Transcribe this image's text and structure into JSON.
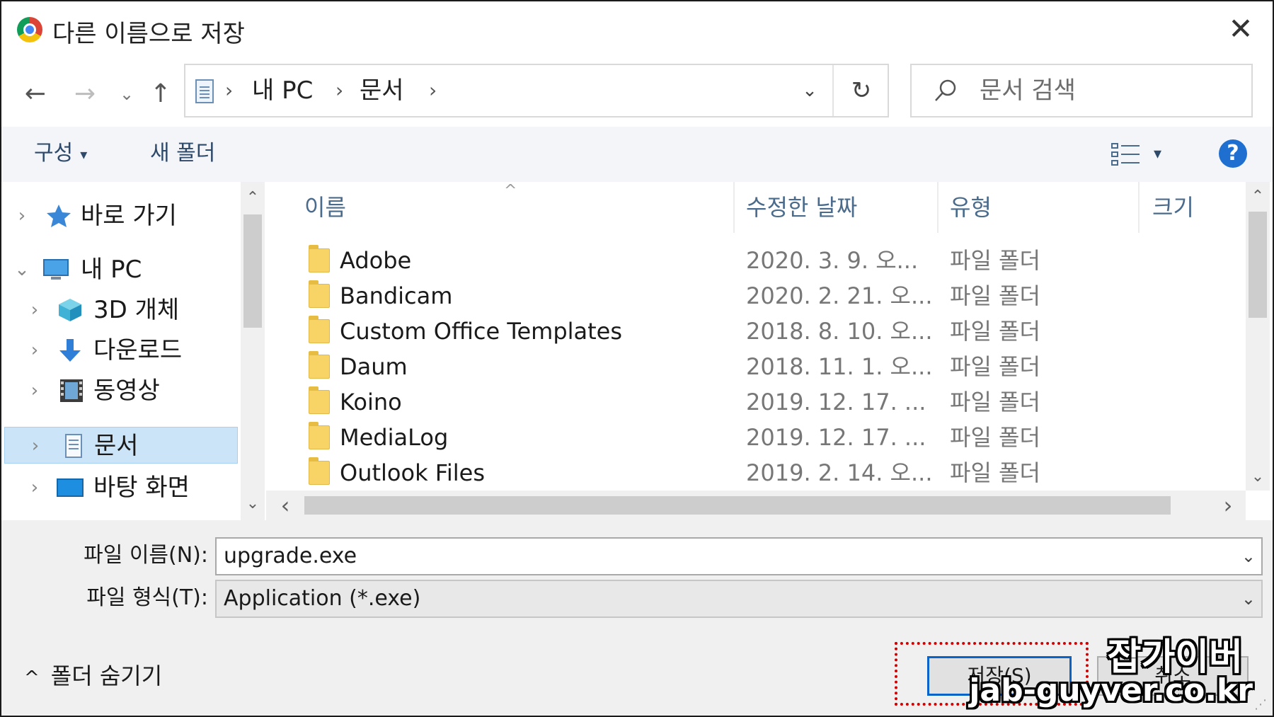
{
  "window": {
    "title": "다른 이름으로 저장",
    "close_glyph": "✕"
  },
  "nav": {
    "back_glyph": "←",
    "forward_glyph": "→",
    "recent_glyph": "⌄",
    "up_glyph": "↑",
    "breadcrumbs": [
      "내 PC",
      "문서"
    ],
    "crumb_sep": "›",
    "dropdown_glyph": "⌄",
    "refresh_glyph": "↻",
    "search_placeholder": "문서 검색"
  },
  "toolbar": {
    "organize_label": "구성",
    "caret": "▾",
    "new_folder_label": "새 폴더",
    "help_glyph": "?"
  },
  "tree": {
    "items": [
      {
        "label": "바로 가기",
        "icon": "star-icon",
        "chevron": "›"
      },
      {
        "label": "내 PC",
        "icon": "computer-icon",
        "chevron": "⌄"
      },
      {
        "label": "3D 개체",
        "icon": "cube-icon",
        "chevron": "›"
      },
      {
        "label": "다운로드",
        "icon": "download-icon",
        "chevron": "›"
      },
      {
        "label": "동영상",
        "icon": "video-icon",
        "chevron": "›"
      },
      {
        "label": "문서",
        "icon": "document-icon",
        "chevron": "›",
        "selected": true
      },
      {
        "label": "바탕 화면",
        "icon": "desktop-icon",
        "chevron": "›"
      }
    ]
  },
  "files": {
    "columns": {
      "name": "이름",
      "modified": "수정한 날짜",
      "type": "유형",
      "size": "크기"
    },
    "sort_glyph": "^",
    "rows": [
      {
        "name": "Adobe",
        "modified": "2020. 3. 9. 오...",
        "type": "파일 폴더"
      },
      {
        "name": "Bandicam",
        "modified": "2020. 2. 21. 오...",
        "type": "파일 폴더"
      },
      {
        "name": "Custom Office Templates",
        "modified": "2018. 8. 10. 오...",
        "type": "파일 폴더"
      },
      {
        "name": "Daum",
        "modified": "2018. 11. 1. 오...",
        "type": "파일 폴더"
      },
      {
        "name": "Koino",
        "modified": "2019. 12. 17. ...",
        "type": "파일 폴더"
      },
      {
        "name": "MediaLog",
        "modified": "2019. 12. 17. ...",
        "type": "파일 폴더"
      },
      {
        "name": "Outlook Files",
        "modified": "2019. 2. 14. 오...",
        "type": "파일 폴더"
      }
    ]
  },
  "scroll": {
    "up": "⌃",
    "down": "⌄",
    "left": "‹",
    "right": "›"
  },
  "form": {
    "filename_label": "파일 이름(N):",
    "filename_value": "upgrade.exe",
    "filetype_label": "파일 형식(T):",
    "filetype_value": "Application (*.exe)",
    "dropdown_glyph": "⌄"
  },
  "footer": {
    "hide_folders_label": "폴더 숨기기",
    "hide_caret": "^",
    "save_label": "저장(S)",
    "cancel_label": "취소",
    "grip_glyph": "⋰"
  },
  "watermark": {
    "name": "잡가이버",
    "url": "jab-guyver.co.kr"
  },
  "colors": {
    "accent": "#0a64c8",
    "selection": "#cce4f7",
    "highlight_outline": "#d00000",
    "folder": "#f8d366"
  }
}
